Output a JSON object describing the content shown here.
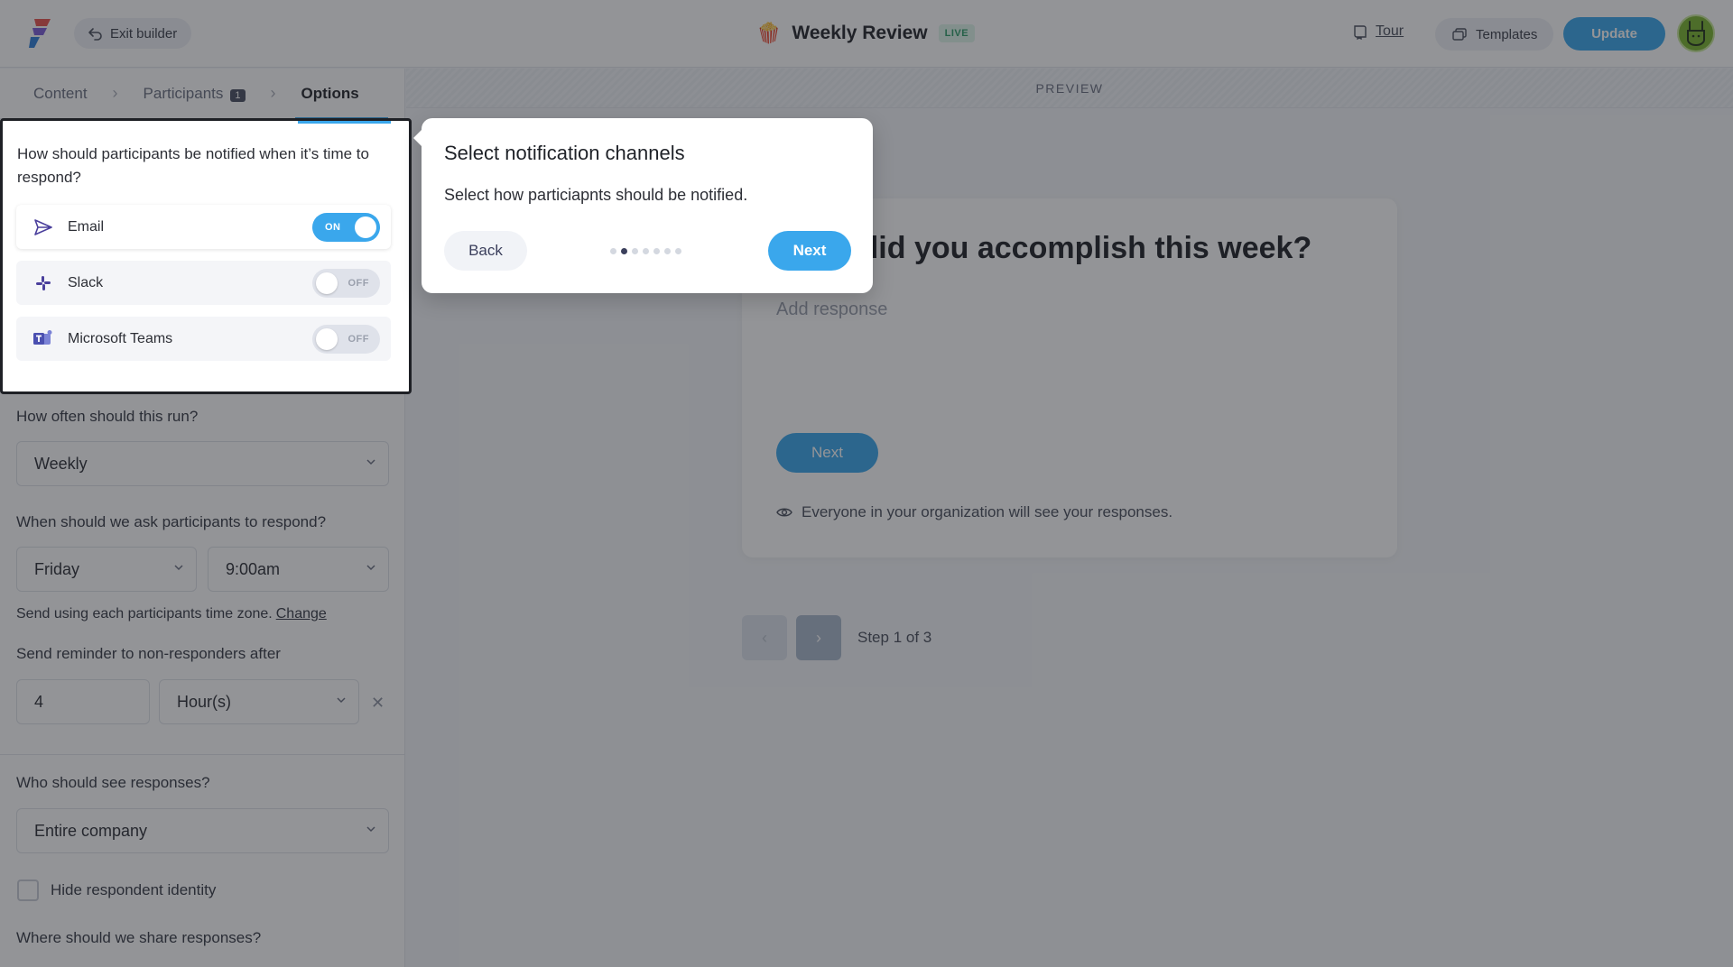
{
  "header": {
    "exit_label": "Exit builder",
    "title_emoji": "🍿",
    "title": "Weekly Review",
    "status_badge": "LIVE",
    "tour_label": "Tour",
    "templates_label": "Templates",
    "update_label": "Update"
  },
  "steps": {
    "content": "Content",
    "participants": "Participants",
    "participants_count": "1",
    "options": "Options"
  },
  "notify": {
    "question": "How should participants be notified when it’s time to respond?",
    "channels": [
      {
        "label": "Email",
        "state": "ON",
        "icon": "send-icon"
      },
      {
        "label": "Slack",
        "state": "OFF",
        "icon": "slack-icon"
      },
      {
        "label": "Microsoft Teams",
        "state": "OFF",
        "icon": "teams-icon"
      }
    ]
  },
  "schedule": {
    "frequency_label": "How often should this run?",
    "frequency_value": "Weekly",
    "when_label": "When should we ask participants to respond?",
    "day_value": "Friday",
    "time_value": "9:00am",
    "timezone_text": "Send using each participants time zone.",
    "timezone_link": "Change",
    "reminder_label": "Send reminder to non-responders after",
    "reminder_amount": "4",
    "reminder_unit": "Hour(s)"
  },
  "visibility": {
    "label": "Who should see responses?",
    "value": "Entire company",
    "hide_identity_label": "Hide respondent identity",
    "share_label": "Where should we share responses?"
  },
  "preview": {
    "bar_label": "PREVIEW",
    "question": "What did you accomplish this week?",
    "input_placeholder": "Add response",
    "next_label": "Next",
    "visibility_note": "Everyone in your organization will see your responses.",
    "pager_prev": "‹",
    "pager_next": "›",
    "step_text": "Step 1 of 3"
  },
  "tour_popover": {
    "title": "Select notification channels",
    "body": "Select how particiapnts should be notified.",
    "back_label": "Back",
    "next_label": "Next",
    "total_steps": 7,
    "current_step": 2
  },
  "colors": {
    "accent": "#3aa7ec",
    "avatar": "#7ab52f",
    "live_badge": "#2f9e6a"
  }
}
